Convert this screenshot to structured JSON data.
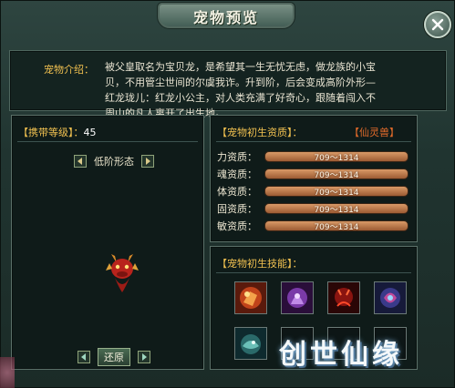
{
  "window": {
    "title": "宠物预览"
  },
  "intro": {
    "label": "宠物介绍：",
    "line1": "被父皇取名为宝贝龙，是希望其一生无忧无虑，做龙族的小宝",
    "line2": "贝，不用管尘世间的尔虞我诈。升到阶，后会变成高阶外形—",
    "line3": "红龙珑儿：红龙小公主，对人类充满了好奇心，跟随着闯入不",
    "line4": "周山的凡人离开了出生地。"
  },
  "left_panel": {
    "level_label": "【携带等级】：",
    "level_value": "45",
    "form_label": "低阶形态",
    "reset_label": "还原"
  },
  "aptitude": {
    "heading": "【宠物初生资质】：",
    "rarity": "【仙灵兽】",
    "stats": [
      {
        "label": "力资质：",
        "value": "709～1314"
      },
      {
        "label": "魂资质：",
        "value": "709～1314"
      },
      {
        "label": "体资质：",
        "value": "709～1314"
      },
      {
        "label": "固资质：",
        "value": "709～1314"
      },
      {
        "label": "敏资质：",
        "value": "709～1314"
      }
    ]
  },
  "skills": {
    "heading": "【宠物初生技能】：",
    "icons": [
      "fist-fire-skill-icon",
      "purple-aura-skill-icon",
      "demon-skill-icon",
      "blue-swirl-skill-icon",
      "sea-creature-skill-icon"
    ]
  },
  "watermark": "创世仙缘",
  "colors": {
    "accent_gold": "#f0c050",
    "rarity_orange": "#e06a2a",
    "bar": "#c8875a"
  }
}
